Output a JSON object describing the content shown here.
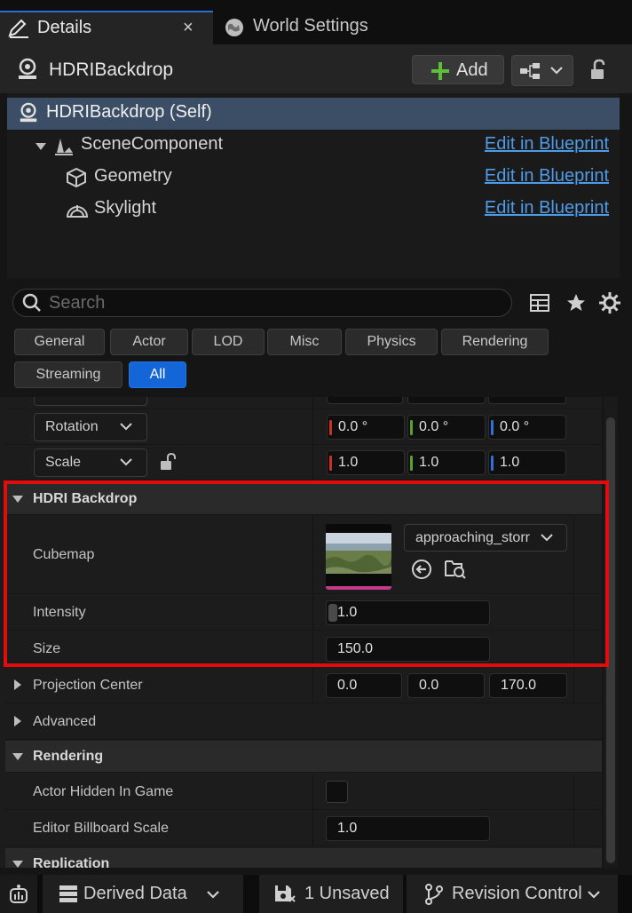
{
  "tabs": {
    "details_label": "Details",
    "close_glyph": "×",
    "world_settings_label": "World Settings"
  },
  "header": {
    "actor_name": "HDRIBackdrop",
    "add_label": "Add"
  },
  "components": [
    {
      "label": "HDRIBackdrop (Self)",
      "link": ""
    },
    {
      "label": "SceneComponent",
      "link": "Edit in Blueprint"
    },
    {
      "label": "Geometry",
      "link": "Edit in Blueprint"
    },
    {
      "label": "Skylight",
      "link": "Edit in Blueprint"
    }
  ],
  "search": {
    "placeholder": "Search"
  },
  "filters": [
    "General",
    "Actor",
    "LOD",
    "Misc",
    "Physics",
    "Rendering",
    "Streaming",
    "All"
  ],
  "active_filter": "All",
  "transform": {
    "rotation_label": "Rotation",
    "rotation": [
      "0.0 °",
      "0.0 °",
      "0.0 °"
    ],
    "scale_label": "Scale",
    "scale": [
      "1.0",
      "1.0",
      "1.0"
    ]
  },
  "hdri": {
    "category": "HDRI Backdrop",
    "cubemap_label": "Cubemap",
    "cubemap_asset": "approaching_storr",
    "intensity_label": "Intensity",
    "intensity": "1.0",
    "size_label": "Size",
    "size": "150.0"
  },
  "projection": {
    "label": "Projection Center",
    "values": [
      "0.0",
      "0.0",
      "170.0"
    ]
  },
  "advanced_label": "Advanced",
  "rendering": {
    "category": "Rendering",
    "hidden_label": "Actor Hidden In Game",
    "billboard_label": "Editor Billboard Scale",
    "billboard_value": "1.0"
  },
  "replication_label": "Replication",
  "statusbar": {
    "derived_data": "Derived Data",
    "unsaved": "1 Unsaved",
    "revision_control": "Revision Control"
  },
  "colors": {
    "accent": "#1466d8",
    "highlight": "#e10c0c",
    "link": "#4f9be8",
    "x_axis": "#c8321e",
    "y_axis": "#5aa02c",
    "z_axis": "#2f6fd6"
  }
}
